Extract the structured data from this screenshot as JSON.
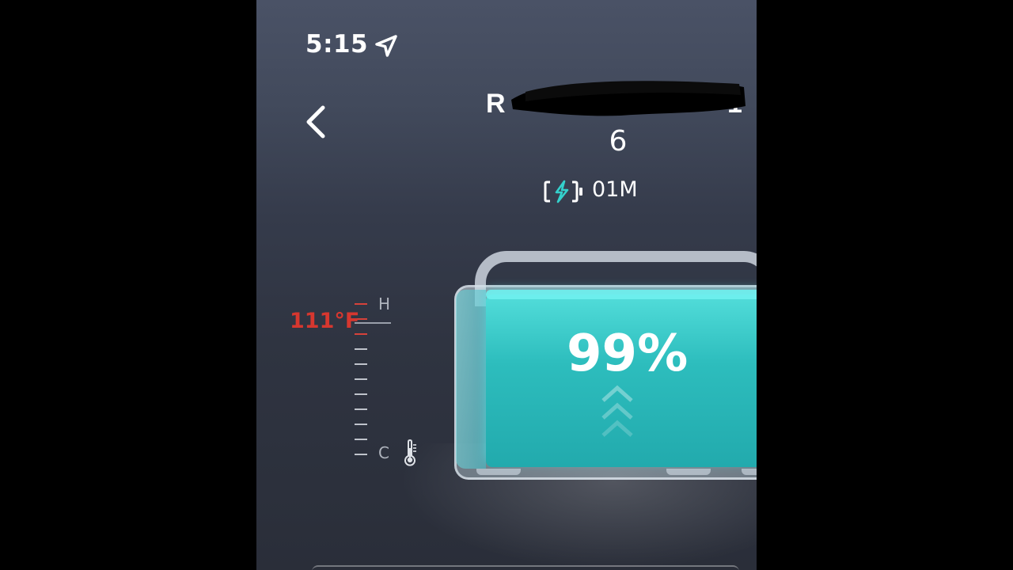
{
  "status_bar": {
    "time": "5:15",
    "location_icon": "location-arrow-icon"
  },
  "header": {
    "back_icon": "chevron-left-icon",
    "device_name_start": "R",
    "device_name_end": "1",
    "device_name_line2": "6",
    "charge_icon": "battery-charging-icon",
    "charge_time": "01M"
  },
  "temperature": {
    "reading": "111°F",
    "high_label": "H",
    "low_label": "C",
    "icon": "thermometer-icon",
    "reading_color": "#d6372f"
  },
  "battery": {
    "percent_label": "99%",
    "level": 0.99,
    "fill_color": "#2dbdbd",
    "arrows_icon": "charging-chevrons-icon"
  }
}
